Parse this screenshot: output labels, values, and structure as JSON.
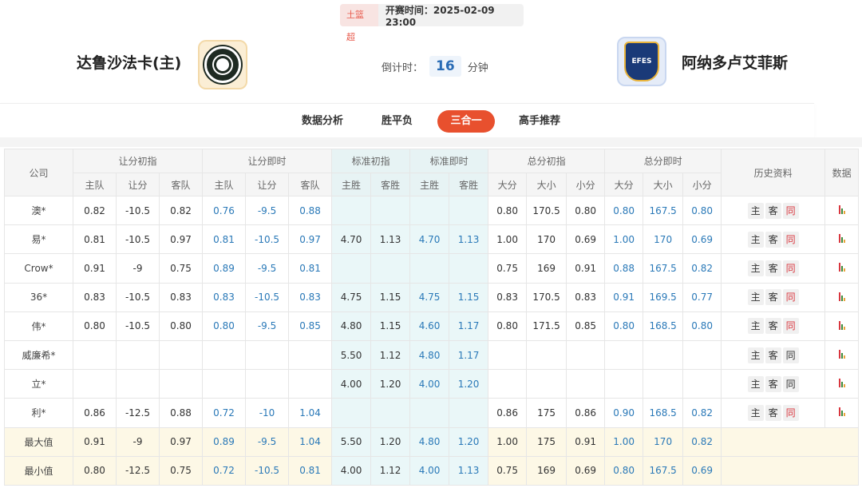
{
  "header": {
    "league": "土篮超",
    "kickoff": "开赛时间：2025-02-09 23:00",
    "home_team": "达鲁沙法卡(主)",
    "away_team": "阿纳多卢艾菲斯",
    "away_logo_text": "EFES",
    "countdown_label": "倒计时：",
    "countdown_value": "16",
    "countdown_unit": "分钟"
  },
  "tabs": [
    {
      "label": "数据分析",
      "active": false
    },
    {
      "label": "胜平负",
      "active": false
    },
    {
      "label": "三合一",
      "active": true
    },
    {
      "label": "高手推荐",
      "active": false
    }
  ],
  "colors": {
    "accent": "#e8502e",
    "value_blue": "#2a79b8",
    "odds_bg": "#eaf7f8",
    "summary_bg": "#fdf8e6"
  },
  "table": {
    "group_headers": {
      "company": "公司",
      "handicap_init": "让分初指",
      "handicap_live": "让分即时",
      "std_init": "标准初指",
      "std_live": "标准即时",
      "total_init": "总分初指",
      "total_live": "总分即时",
      "history": "历史资料",
      "data": "数据"
    },
    "sub_headers": [
      "主队",
      "让分",
      "客队",
      "主队",
      "让分",
      "客队",
      "主胜",
      "客胜",
      "主胜",
      "客胜",
      "大分",
      "大小",
      "小分",
      "大分",
      "大小",
      "小分"
    ],
    "history_buttons": [
      "主",
      "客",
      "同"
    ],
    "rows": [
      {
        "company": "澳*",
        "h": [
          "0.82",
          "-10.5",
          "0.82",
          "0.76",
          "-9.5",
          "0.88"
        ],
        "s": [
          "",
          "",
          "",
          ""
        ],
        "t": [
          "0.80",
          "170.5",
          "0.80",
          "0.80",
          "167.5",
          "0.80"
        ],
        "same_red": true
      },
      {
        "company": "易*",
        "h": [
          "0.81",
          "-10.5",
          "0.97",
          "0.81",
          "-10.5",
          "0.97"
        ],
        "s": [
          "4.70",
          "1.13",
          "4.70",
          "1.13"
        ],
        "t": [
          "1.00",
          "170",
          "0.69",
          "1.00",
          "170",
          "0.69"
        ],
        "same_red": true
      },
      {
        "company": "Crow*",
        "h": [
          "0.91",
          "-9",
          "0.75",
          "0.89",
          "-9.5",
          "0.81"
        ],
        "s": [
          "",
          "",
          "",
          ""
        ],
        "t": [
          "0.75",
          "169",
          "0.91",
          "0.88",
          "167.5",
          "0.82"
        ],
        "same_red": true
      },
      {
        "company": "36*",
        "h": [
          "0.83",
          "-10.5",
          "0.83",
          "0.83",
          "-10.5",
          "0.83"
        ],
        "s": [
          "4.75",
          "1.15",
          "4.75",
          "1.15"
        ],
        "t": [
          "0.83",
          "170.5",
          "0.83",
          "0.91",
          "169.5",
          "0.77"
        ],
        "same_red": true
      },
      {
        "company": "伟*",
        "h": [
          "0.80",
          "-10.5",
          "0.80",
          "0.80",
          "-9.5",
          "0.85"
        ],
        "s": [
          "4.80",
          "1.15",
          "4.60",
          "1.17"
        ],
        "t": [
          "0.80",
          "171.5",
          "0.85",
          "0.80",
          "168.5",
          "0.80"
        ],
        "same_red": true
      },
      {
        "company": "威廉希*",
        "h": [
          "",
          "",
          "",
          "",
          "",
          ""
        ],
        "s": [
          "5.50",
          "1.12",
          "4.80",
          "1.17"
        ],
        "t": [
          "",
          "",
          "",
          "",
          "",
          ""
        ],
        "same_red": false
      },
      {
        "company": "立*",
        "h": [
          "",
          "",
          "",
          "",
          "",
          ""
        ],
        "s": [
          "4.00",
          "1.20",
          "4.00",
          "1.20"
        ],
        "t": [
          "",
          "",
          "",
          "",
          "",
          ""
        ],
        "same_red": false
      },
      {
        "company": "利*",
        "h": [
          "0.86",
          "-12.5",
          "0.88",
          "0.72",
          "-10",
          "1.04"
        ],
        "s": [
          "",
          "",
          "",
          ""
        ],
        "t": [
          "0.86",
          "175",
          "0.86",
          "0.90",
          "168.5",
          "0.82"
        ],
        "same_red": true
      }
    ],
    "summary": [
      {
        "label": "最大值",
        "h": [
          "0.91",
          "-9",
          "0.97",
          "0.89",
          "-9.5",
          "1.04"
        ],
        "s": [
          "5.50",
          "1.20",
          "4.80",
          "1.20"
        ],
        "t": [
          "1.00",
          "175",
          "0.91",
          "1.00",
          "170",
          "0.82"
        ]
      },
      {
        "label": "最小值",
        "h": [
          "0.80",
          "-12.5",
          "0.75",
          "0.72",
          "-10.5",
          "0.81"
        ],
        "s": [
          "4.00",
          "1.12",
          "4.00",
          "1.13"
        ],
        "t": [
          "0.75",
          "169",
          "0.69",
          "0.80",
          "167.5",
          "0.69"
        ]
      }
    ]
  }
}
